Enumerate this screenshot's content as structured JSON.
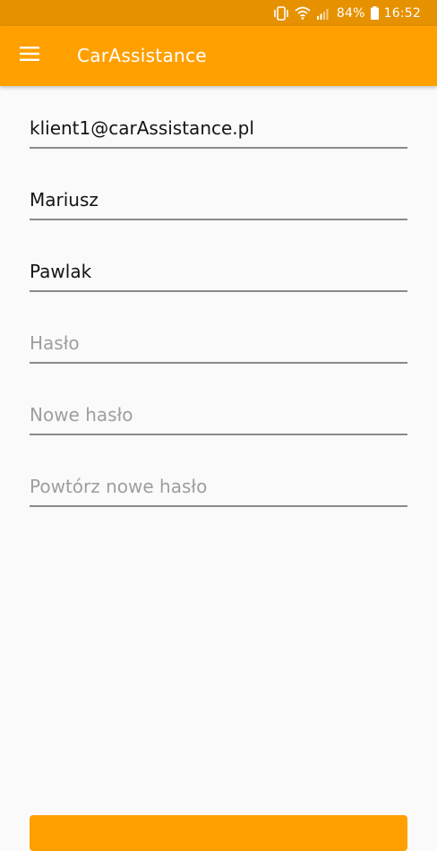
{
  "status_bar": {
    "battery_percent": "84%",
    "time": "16:52",
    "icons": [
      "vibrate-icon",
      "wifi-icon",
      "signal-icon",
      "battery-icon"
    ]
  },
  "app_bar": {
    "menu_icon": "hamburger-menu-icon",
    "title": "CarAssistance"
  },
  "form": {
    "email": {
      "value": "klient1@carAssistance.pl",
      "placeholder": ""
    },
    "first_name": {
      "value": "Mariusz",
      "placeholder": ""
    },
    "last_name": {
      "value": "Pawlak",
      "placeholder": ""
    },
    "password": {
      "value": "",
      "placeholder": "Hasło"
    },
    "new_password": {
      "value": "",
      "placeholder": "Nowe hasło"
    },
    "repeat_new_password": {
      "value": "",
      "placeholder": "Powtórz nowe hasło"
    }
  },
  "colors": {
    "primary": "#ffa000",
    "primary_dark": "#e69100",
    "background": "#fafafa",
    "underline": "#8a8a8a",
    "hint": "#9e9e9e"
  }
}
